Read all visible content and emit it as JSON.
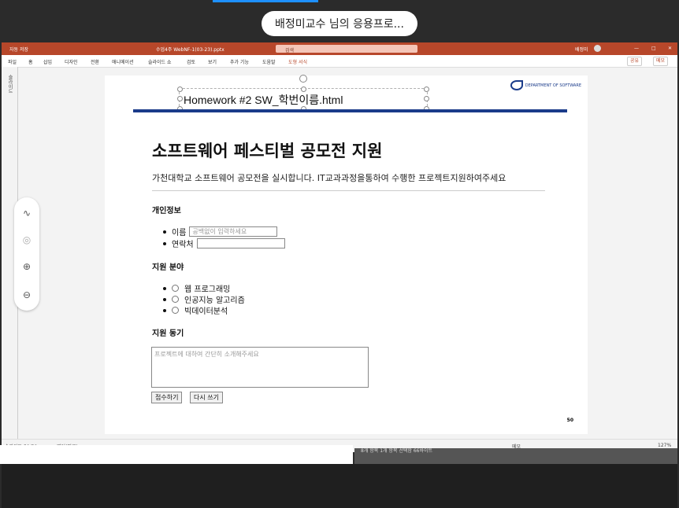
{
  "share": {
    "label": "배정미교수 님의 응용프로..."
  },
  "ppt": {
    "autosave": "자동 저장",
    "filename": "수업4주 WebNF-1(03-23).pptx",
    "search": "검색",
    "user": "배정미",
    "ribbon_tabs": [
      "파일",
      "홈",
      "삽입",
      "디자인",
      "전환",
      "애니메이션",
      "슬라이드 쇼",
      "검토",
      "보기",
      "추가 기능",
      "도움말",
      "도형 서식"
    ],
    "share_btn": "공유",
    "memo_btn": "메모",
    "left_panel": "슬라이드"
  },
  "slide": {
    "logo_text": "DEPARTMENT OF SOFTWARE",
    "title": "Homework #2 SW_학번이름.html",
    "heading": "소프트웨어 페스티벌 공모전 지원",
    "lead": "가천대학교 소프트웨어 공모전을 실시합니다. IT교과과정을통하여 수행한 프로젝트지원하여주세요",
    "section_personal": "개인정보",
    "name_label": "이름",
    "name_placeholder": "공백없이 입력하세요",
    "contact_label": "연락처",
    "section_field": "지원 분야",
    "fields": [
      "웹 프로그래밍",
      "인공지능 알고리즘",
      "빅데이터분석"
    ],
    "section_motive": "지원 동기",
    "motive_placeholder": "프로젝트에 대하여 간단히 소개해주세요",
    "submit": "접수하기",
    "reset": "다시 쓰기",
    "page": "50"
  },
  "status": {
    "slide_count": "슬라이드 50/50",
    "language": "영어(미국)",
    "notes": "슬라이드 노트",
    "zoom": "127%",
    "memo": "메모",
    "notes_text": "8개 항목     1개 항목 선택함 66바이트"
  }
}
